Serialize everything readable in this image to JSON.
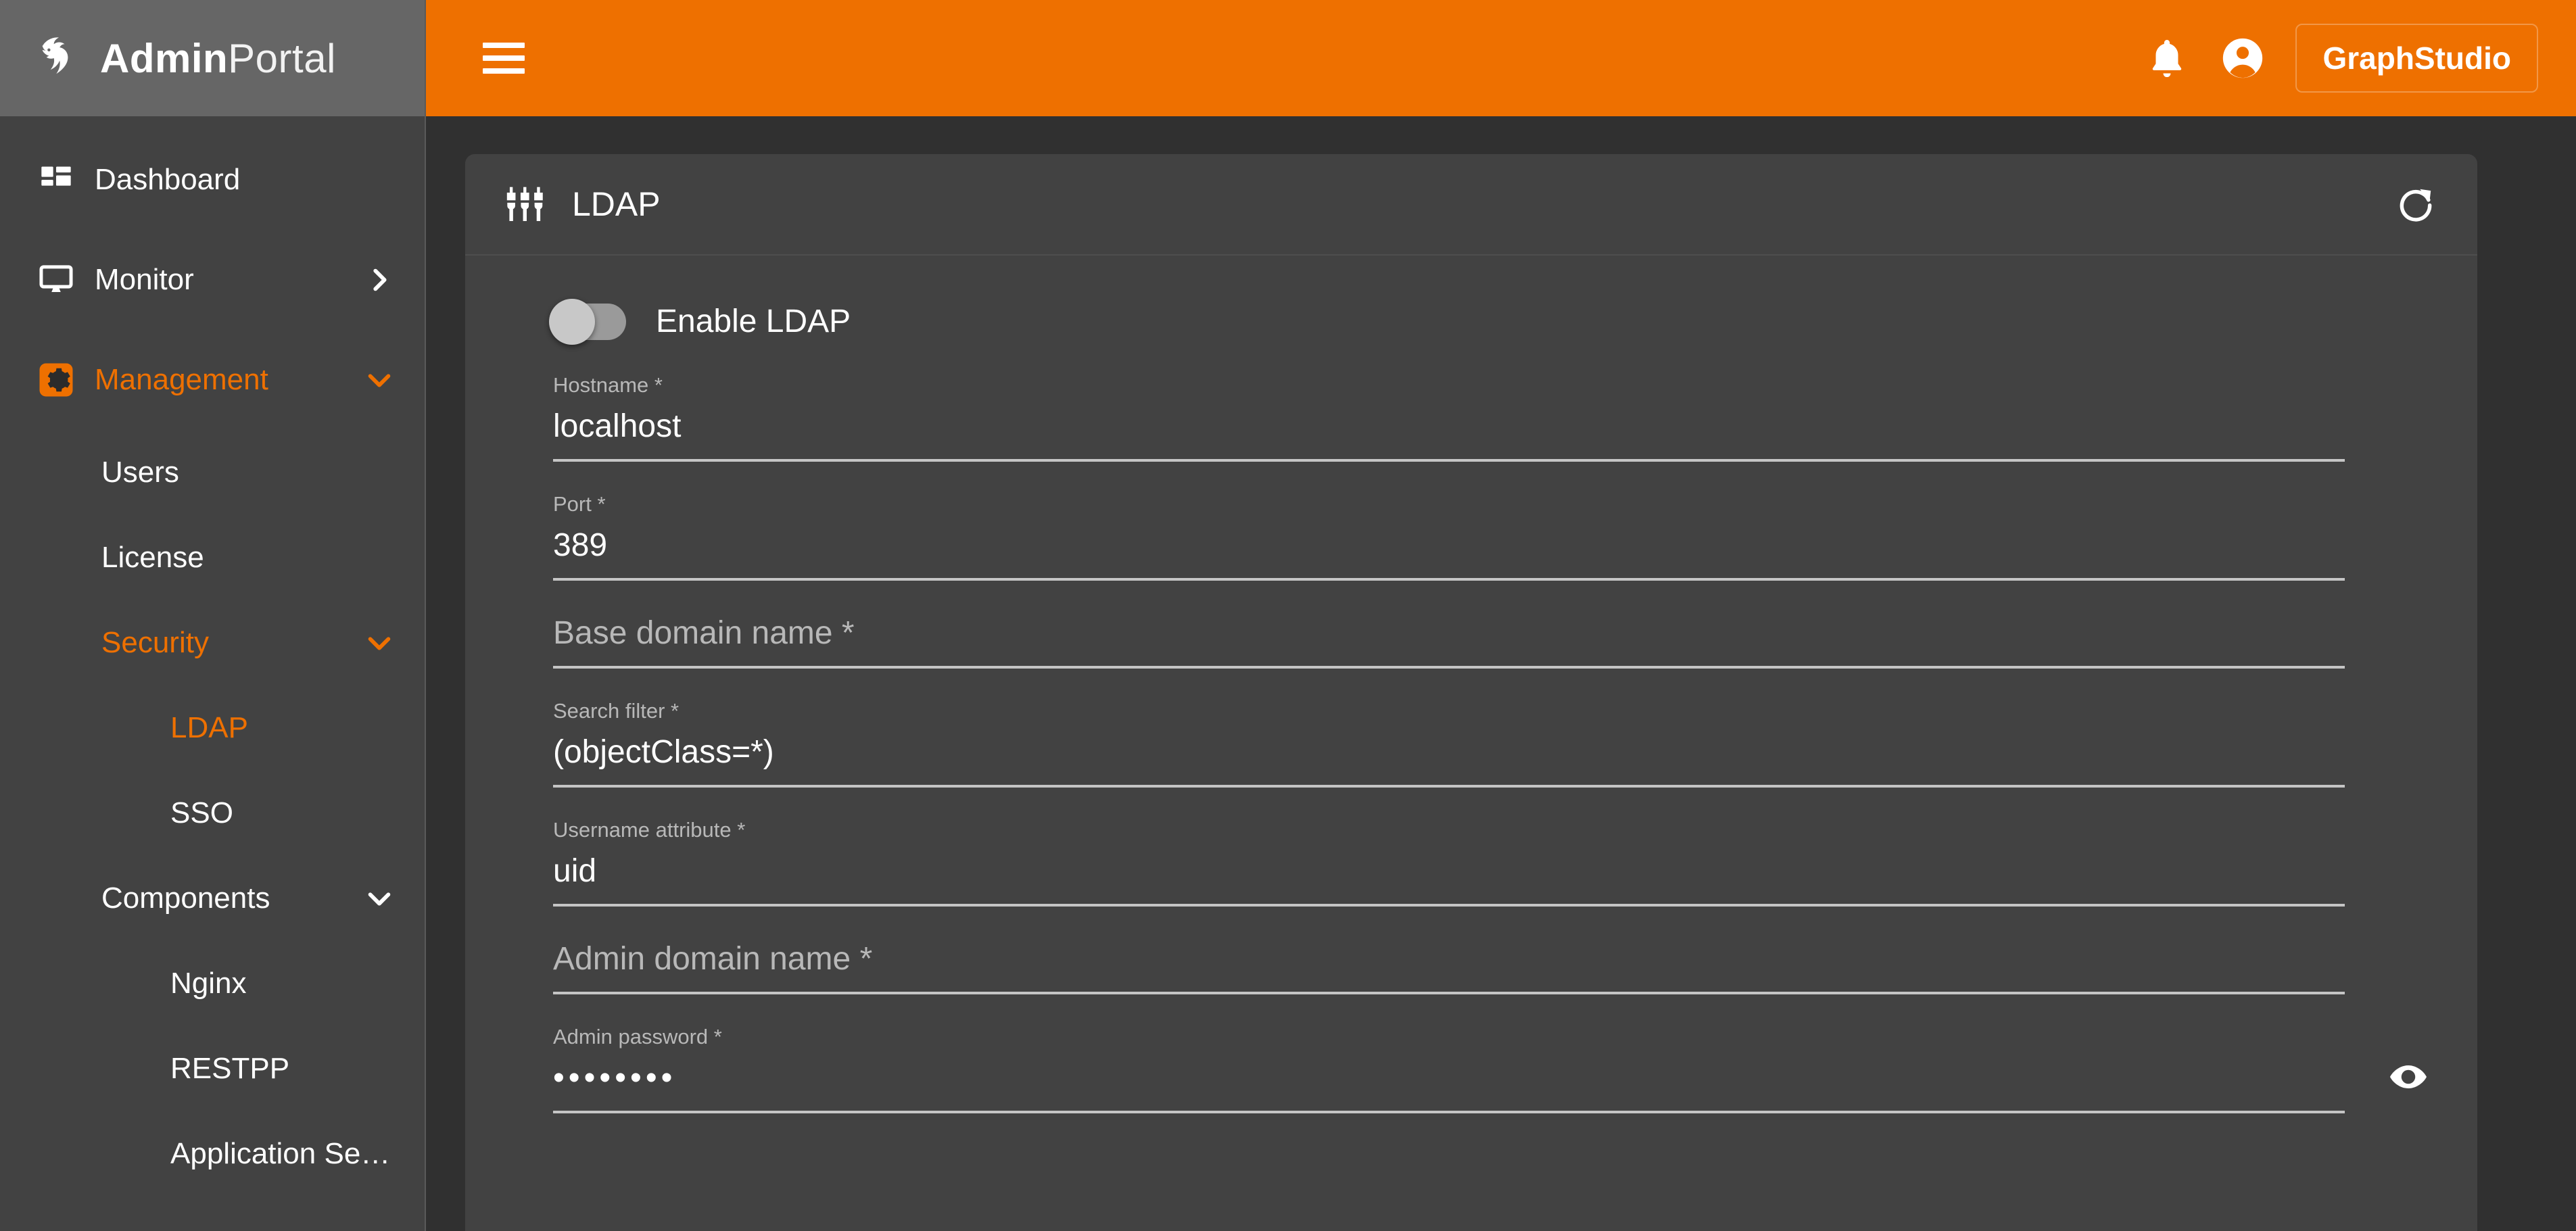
{
  "colors": {
    "accent": "#ee7000",
    "sidebar_bg": "#424242",
    "brand_bg": "#666666",
    "page_bg": "#303030",
    "card_bg": "#424242",
    "text": "#ffffff",
    "muted_text": "#b8b8b8",
    "underline": "#c5c5c5"
  },
  "brand": {
    "name_bold": "Admin",
    "name_light": "Portal",
    "logo_icon": "tiger-head-logo"
  },
  "topbar": {
    "menu_icon": "hamburger-menu-icon",
    "notifications_icon": "bell-icon",
    "account_icon": "account-circle-icon",
    "graphstudio_label": "GraphStudio"
  },
  "sidebar": {
    "items": [
      {
        "label": "Dashboard",
        "icon": "dashboard-grid-icon",
        "level": 1,
        "active": false,
        "chevron": "none"
      },
      {
        "label": "Monitor",
        "icon": "monitor-icon",
        "level": 1,
        "active": false,
        "chevron": "right"
      },
      {
        "label": "Management",
        "icon": "settings-gear-icon",
        "level": 1,
        "active": true,
        "chevron": "down"
      },
      {
        "label": "Users",
        "icon": "",
        "level": 2,
        "active": false,
        "chevron": "none"
      },
      {
        "label": "License",
        "icon": "",
        "level": 2,
        "active": false,
        "chevron": "none"
      },
      {
        "label": "Security",
        "icon": "",
        "level": 2,
        "active": true,
        "chevron": "down"
      },
      {
        "label": "LDAP",
        "icon": "",
        "level": 3,
        "active": true,
        "chevron": "none"
      },
      {
        "label": "SSO",
        "icon": "",
        "level": 3,
        "active": false,
        "chevron": "none"
      },
      {
        "label": "Components",
        "icon": "",
        "level": 2,
        "active": false,
        "chevron": "down"
      },
      {
        "label": "Nginx",
        "icon": "",
        "level": 3,
        "active": false,
        "chevron": "none"
      },
      {
        "label": "RESTPP",
        "icon": "",
        "level": 3,
        "active": false,
        "chevron": "none"
      },
      {
        "label": "Application Serv…",
        "icon": "",
        "level": 3,
        "active": false,
        "chevron": "none"
      }
    ]
  },
  "card": {
    "title": "LDAP",
    "title_icon": "ldap-plugs-icon",
    "refresh_icon": "refresh-icon"
  },
  "form": {
    "enable_toggle": {
      "label": "Enable LDAP",
      "checked": false
    },
    "fields": [
      {
        "label": "Hostname *",
        "value": "localhost",
        "empty": false,
        "password": false
      },
      {
        "label": "Port *",
        "value": "389",
        "empty": false,
        "password": false
      },
      {
        "label": "Base domain name *",
        "value": "",
        "empty": true,
        "password": false
      },
      {
        "label": "Search filter *",
        "value": "(objectClass=*)",
        "empty": false,
        "password": false
      },
      {
        "label": "Username attribute *",
        "value": "uid",
        "empty": false,
        "password": false
      },
      {
        "label": "Admin domain name *",
        "value": "",
        "empty": true,
        "password": false
      },
      {
        "label": "Admin password *",
        "value": "••••••••",
        "empty": false,
        "password": true,
        "toggle_visibility_icon": "eye-icon"
      }
    ]
  }
}
